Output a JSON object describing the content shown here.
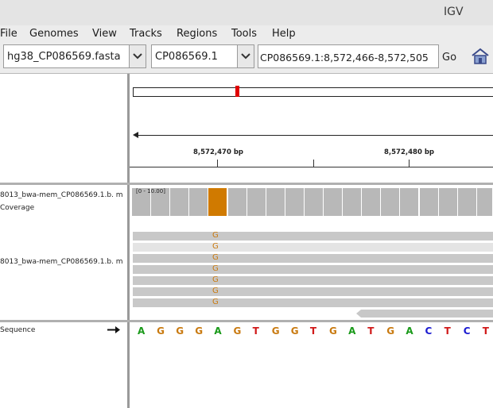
{
  "window": {
    "title": "IGV"
  },
  "menu": [
    "File",
    "Genomes",
    "View",
    "Tracks",
    "Regions",
    "Tools",
    "Help"
  ],
  "toolbar": {
    "genome": "hg38_CP086569.fasta",
    "chromosome": "CP086569.1",
    "locus": "CP086569.1:8,572,466-8,572,505",
    "go_label": "Go"
  },
  "ruler": {
    "tick_labels": [
      "8,572,470 bp",
      "8,572,480 bp"
    ]
  },
  "tracks": {
    "coverage_name": "8013_bwa-mem_CP086569.1.b. m Coverage",
    "coverage_range": "[0 - 10.00]",
    "alignment_name": "8013_bwa-mem_CP086569.1.b. m",
    "sequence_name": "Sequence",
    "mismatch_base": "G"
  },
  "sequence": [
    "A",
    "G",
    "G",
    "G",
    "A",
    "G",
    "T",
    "G",
    "G",
    "T",
    "G",
    "A",
    "T",
    "G",
    "A",
    "C",
    "T",
    "C",
    "T"
  ],
  "colors": {
    "A": "#1a9a1a",
    "C": "#1a1ad0",
    "G": "#c97a10",
    "T": "#d01a1a",
    "coverage": "#b8b8b8",
    "mismatch": "#d07a00"
  }
}
